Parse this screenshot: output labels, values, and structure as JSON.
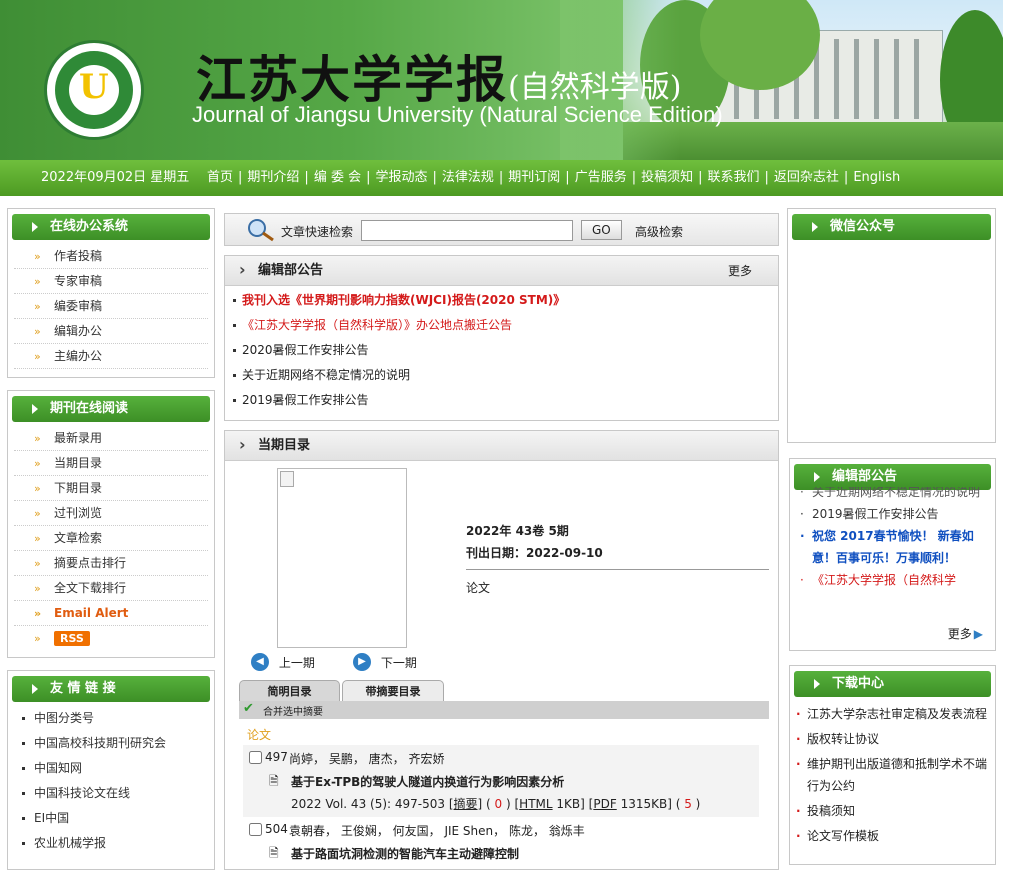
{
  "colors": {
    "brand_green": "#4d9a22",
    "accent_red": "#d41a1a",
    "email_alert": "#e05c10",
    "rss_bg": "#f07000"
  },
  "banner": {
    "logo_year": "1902",
    "logo_ring_text": "JIANGSU UNIVERSITY",
    "title_cn": "江苏大学学报",
    "title_cn_suffix": "(自然科学版)",
    "title_en": "Journal of Jiangsu University (Natural Science Edition)"
  },
  "nav": {
    "date": "2022年09月02日 星期五",
    "links": [
      "首页",
      "期刊介绍",
      "编 委 会",
      "学报动态",
      "法律法规",
      "期刊订阅",
      "广告服务",
      "投稿须知",
      "联系我们",
      "返回杂志社",
      "English"
    ]
  },
  "left": {
    "office": {
      "title": "在线办公系统",
      "items": [
        "作者投稿",
        "专家审稿",
        "编委审稿",
        "编辑办公",
        "主编办公"
      ]
    },
    "reading": {
      "title": "期刊在线阅读",
      "items": [
        "最新录用",
        "当期目录",
        "下期目录",
        "过刊浏览",
        "文章检索",
        "摘要点击排行",
        "全文下载排行"
      ],
      "email_alert": "Email Alert",
      "rss": "RSS"
    },
    "links": {
      "title": "友 情 链 接",
      "items": [
        "中图分类号",
        "中国高校科技期刊研究会",
        "中国知网",
        "中国科技论文在线",
        "EI中国",
        "农业机械学报"
      ]
    }
  },
  "search": {
    "label": "文章快速检索",
    "placeholder": "",
    "go": "GO",
    "advanced": "高级检索"
  },
  "notices": {
    "title": "编辑部公告",
    "more": "更多",
    "items": [
      {
        "text": "我刊入选《世界期刊影响力指数(WJCI)报告(2020 STM)》",
        "style": "red-bold"
      },
      {
        "text": "《江苏大学学报（自然科学版）》办公地点搬迁公告",
        "style": "red"
      },
      {
        "text": "2020暑假工作安排公告",
        "style": "normal"
      },
      {
        "text": "关于近期网络不稳定情况的说明",
        "style": "normal"
      },
      {
        "text": "2019暑假工作安排公告",
        "style": "normal"
      }
    ]
  },
  "current": {
    "title": "当期目录",
    "issue": "2022年 43卷 5期",
    "publish_date": "刊出日期：2022-09-10",
    "section_label": "论文",
    "prev": "上一期",
    "next": "下一期",
    "tabs": [
      "简明目录",
      "带摘要目录"
    ],
    "merge_label": "合并选中摘要",
    "section": "论文",
    "articles": [
      {
        "page": "497",
        "authors": "尚婷，  吴鹏，  唐杰，  齐宏娇",
        "title": "基于Ex-TPB的驾驶人隧道内换道行为影响因素分析",
        "citation": "2022 Vol. 43 (5): 497-503",
        "abstract_label": "摘要",
        "abstract_count": "0",
        "html_label": "HTML",
        "html_size": "1KB",
        "pdf_label": "PDF",
        "pdf_size": "1315KB",
        "pdf_count": "5"
      },
      {
        "page": "504",
        "authors": "袁朝春，  王俊娴，  何友国，  JIE Shen，  陈龙，  翁烁丰",
        "title": "基于路面坑洞检测的智能汽车主动避障控制"
      }
    ]
  },
  "right": {
    "wechat": {
      "title": "微信公众号"
    },
    "notices": {
      "title": "编辑部公告",
      "more": "更多",
      "items": [
        {
          "text": "关于近期网络不稳定情况的说明",
          "style": "normal"
        },
        {
          "text": "2019暑假工作安排公告",
          "style": "normal"
        },
        {
          "text": "祝您 2017春节愉快！ 新春如意！百事可乐！万事顺利！",
          "style": "blue-bold"
        },
        {
          "text": "《江苏大学学报（自然科学",
          "style": "red"
        }
      ]
    },
    "downloads": {
      "title": "下载中心",
      "items": [
        "江苏大学杂志社审定稿及发表流程",
        "版权转让协议",
        "维护期刊出版道德和抵制学术不端行为公约",
        "投稿须知",
        "论文写作模板"
      ]
    }
  }
}
